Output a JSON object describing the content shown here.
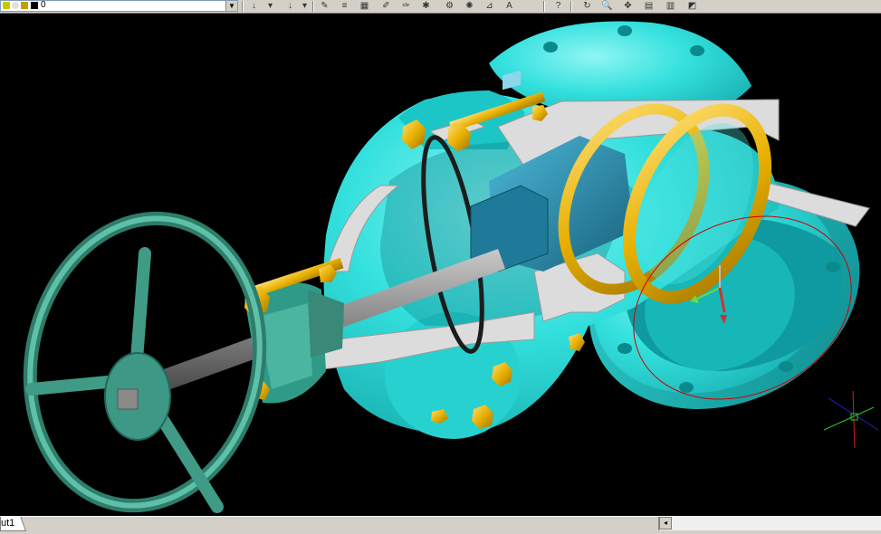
{
  "toolbar": {
    "layer_name": "0",
    "layer_dropdown_arrow": "▼",
    "buttons": [
      {
        "icon": "insert-block-arrow-icon",
        "glyph": "↓"
      },
      {
        "icon": "dropdown-icon",
        "glyph": "▾"
      },
      {
        "icon": "insert-disabled-icon",
        "glyph": "↓"
      },
      {
        "icon": "dropdown-disabled-icon",
        "glyph": "▾"
      },
      {
        "icon": "sketch-icon",
        "glyph": "✎"
      },
      {
        "icon": "properties-icon",
        "glyph": "≡"
      },
      {
        "icon": "design-center-icon",
        "glyph": "▦"
      },
      {
        "icon": "tool-palette-icon",
        "glyph": "✐"
      },
      {
        "icon": "match-properties-icon",
        "glyph": "✑"
      },
      {
        "icon": "markup-icon",
        "glyph": "✱"
      },
      {
        "icon": "render-icon",
        "glyph": "⚙"
      },
      {
        "icon": "materials-icon",
        "glyph": "✺"
      },
      {
        "icon": "lights-icon",
        "glyph": "⊿"
      },
      {
        "icon": "text-style-icon",
        "glyph": "A"
      },
      {
        "icon": "help-icon",
        "glyph": "?"
      },
      {
        "icon": "orbit-icon",
        "glyph": "↻"
      },
      {
        "icon": "zoom-icon",
        "glyph": "🔍"
      },
      {
        "icon": "pan-icon",
        "glyph": "✥"
      },
      {
        "icon": "named-views-icon",
        "glyph": "▤"
      },
      {
        "icon": "view-cube-icon",
        "glyph": "▥"
      },
      {
        "icon": "3d-box-icon",
        "glyph": "◩"
      }
    ]
  },
  "layout": {
    "tab_label": "ut1",
    "scroll_left_glyph": "◂"
  },
  "colors": {
    "toolbar_bg": "#d4d0c8",
    "viewport_bg": "#000000",
    "body_cyan": "#33e0dd",
    "cut_face": "#d8d8d8",
    "brass": "#e8b000",
    "handwheel": "#4aa890",
    "stem": "#888888",
    "gate": "#2a8aa8"
  }
}
